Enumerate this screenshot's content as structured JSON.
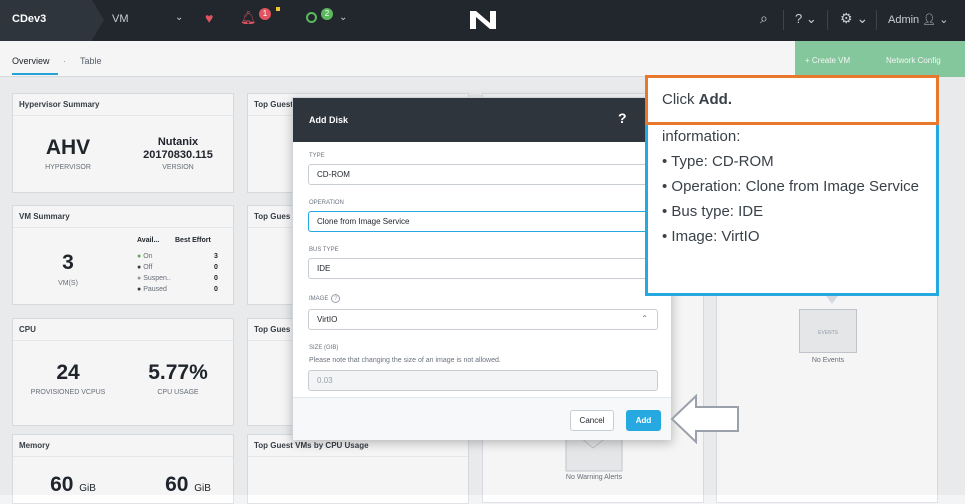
{
  "topbar": {
    "cluster": "CDev3",
    "section": "VM",
    "alert_count": "1",
    "task_count": "2",
    "user": "Admin"
  },
  "subnav": {
    "tab_overview": "Overview",
    "tab_separator": "·",
    "tab_table": "Table",
    "create_vm": "+  Create VM",
    "network_config": "Network Config"
  },
  "cards": {
    "hypervisor": {
      "title": "Hypervisor Summary",
      "name": "AHV",
      "name_label": "HYPERVISOR",
      "version": "Nutanix\n20170830.115",
      "version_label": "VERSION"
    },
    "top_guest_1": "Top Guest",
    "top_guest_2": "Top Gues",
    "top_guest_3": "Top Gues",
    "top_guest_cpu": "Top Guest VMs by CPU Usage",
    "vm_summary": {
      "title": "VM Summary",
      "count": "3",
      "count_label": "VM(S)",
      "col_avail": "Avail...",
      "col_best": "Best Effort",
      "rows": [
        {
          "label": "On",
          "value": "3"
        },
        {
          "label": "Off",
          "value": "0"
        },
        {
          "label": "Suspen..",
          "value": "0"
        },
        {
          "label": "Paused",
          "value": "0"
        }
      ]
    },
    "cpu": {
      "title": "CPU",
      "vcpus": "24",
      "vcpus_label": "PROVISIONED VCPUS",
      "usage": "5.77%",
      "usage_label": "CPU USAGE"
    },
    "memory": {
      "title": "Memory",
      "val1": "60",
      "unit1": "GiB",
      "val2": "60",
      "unit2": "GiB"
    },
    "events_label": "EVENTS",
    "no_events": "No Events",
    "no_warning_alerts": "No Warning Alerts"
  },
  "modal": {
    "title": "Add Disk",
    "help": "?",
    "type_label": "TYPE",
    "type_value": "CD-ROM",
    "operation_label": "OPERATION",
    "operation_value": "Clone from Image Service",
    "bus_label": "BUS TYPE",
    "bus_value": "IDE",
    "image_label": "IMAGE",
    "image_value": "VirtIO",
    "size_label": "SIZE (GIB)",
    "size_note": "Please note that changing the size of an image is not allowed.",
    "size_value": "0.03",
    "cancel": "Cancel",
    "add": "Add"
  },
  "callouts": {
    "click_prefix": "Click ",
    "click_bold": "Add.",
    "info_heading": "information:",
    "items": [
      "• Type: CD-ROM",
      "• Operation: Clone from Image Service",
      "• Bus type: IDE",
      "• Image: VirtIO"
    ]
  },
  "colors": {
    "accent": "#26a8e0",
    "callout_orange": "#e8782b",
    "topbar": "#22272e",
    "green": "#5cb85c",
    "red": "#e0555f"
  }
}
